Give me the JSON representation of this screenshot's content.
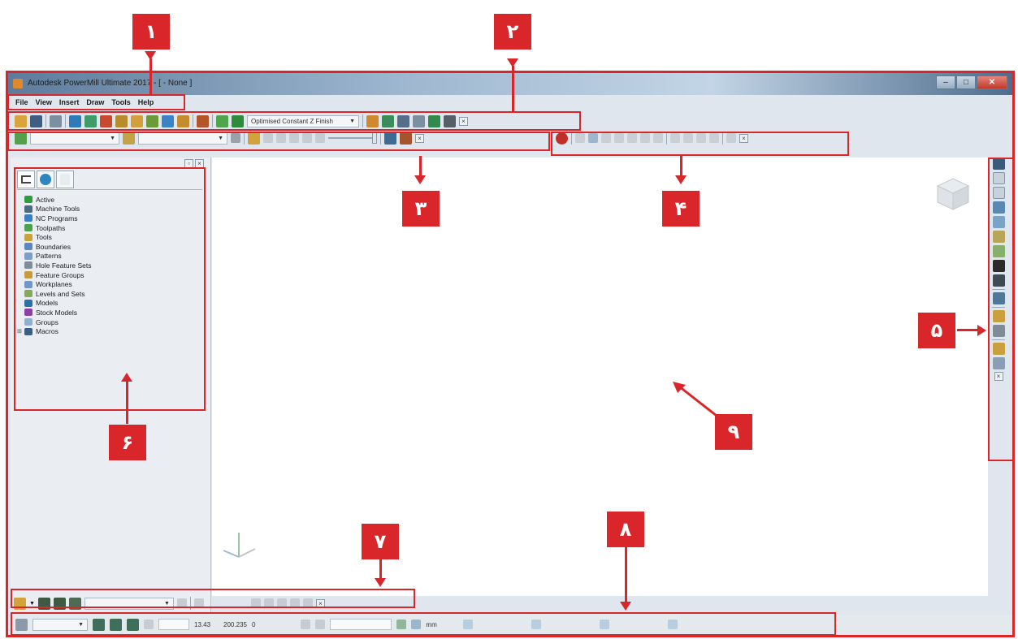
{
  "window": {
    "title": "Autodesk PowerMill Ultimate 2017 - [ - None ]",
    "controls": [
      "–",
      "□",
      "✕"
    ]
  },
  "menu": [
    "File",
    "View",
    "Insert",
    "Draw",
    "Tools",
    "Help"
  ],
  "main_toolbar": {
    "strategy_combo": "Optimised Constant Z Finish"
  },
  "explorer": {
    "items": [
      {
        "label": "Active",
        "icon": "active-icon",
        "color": "#2e9e3f"
      },
      {
        "label": "Machine Tools",
        "icon": "machine-tools-icon",
        "color": "#4d6a83"
      },
      {
        "label": "NC Programs",
        "icon": "nc-programs-icon",
        "color": "#3a7fc1"
      },
      {
        "label": "Toolpaths",
        "icon": "toolpaths-icon",
        "color": "#4aa24a"
      },
      {
        "label": "Tools",
        "icon": "tools-icon",
        "color": "#c9a23a"
      },
      {
        "label": "Boundaries",
        "icon": "boundaries-icon",
        "color": "#5b88c4"
      },
      {
        "label": "Patterns",
        "icon": "patterns-icon",
        "color": "#7aa0c7"
      },
      {
        "label": "Hole Feature Sets",
        "icon": "hole-feature-sets-icon",
        "color": "#7f8d9a"
      },
      {
        "label": "Feature Groups",
        "icon": "feature-groups-icon",
        "color": "#c99a3e"
      },
      {
        "label": "Workplanes",
        "icon": "workplanes-icon",
        "color": "#6d98c8"
      },
      {
        "label": "Levels and Sets",
        "icon": "levels-and-sets-icon",
        "color": "#86a85a"
      },
      {
        "label": "Models",
        "icon": "models-icon",
        "color": "#2f6fa8"
      },
      {
        "label": "Stock Models",
        "icon": "stock-models-icon",
        "color": "#8c3fa6"
      },
      {
        "label": "Groups",
        "icon": "groups-icon",
        "color": "#8fb0cf"
      },
      {
        "label": "Macros",
        "icon": "macros-icon",
        "color": "#3b5f86",
        "expandable": true
      }
    ]
  },
  "statusbar": {
    "coord_a": "13.43",
    "coord_b": "200.235",
    "coord_c": "0",
    "units": "mm"
  },
  "callouts": {
    "c1": "۱",
    "c2": "۲",
    "c3": "۳",
    "c4": "۴",
    "c5": "۵",
    "c6": "۶",
    "c7": "۷",
    "c8": "۸",
    "c9": "۹"
  },
  "colors": {
    "callout_red": "#d9262b",
    "titlebar_blue": "#5d7c9c"
  }
}
